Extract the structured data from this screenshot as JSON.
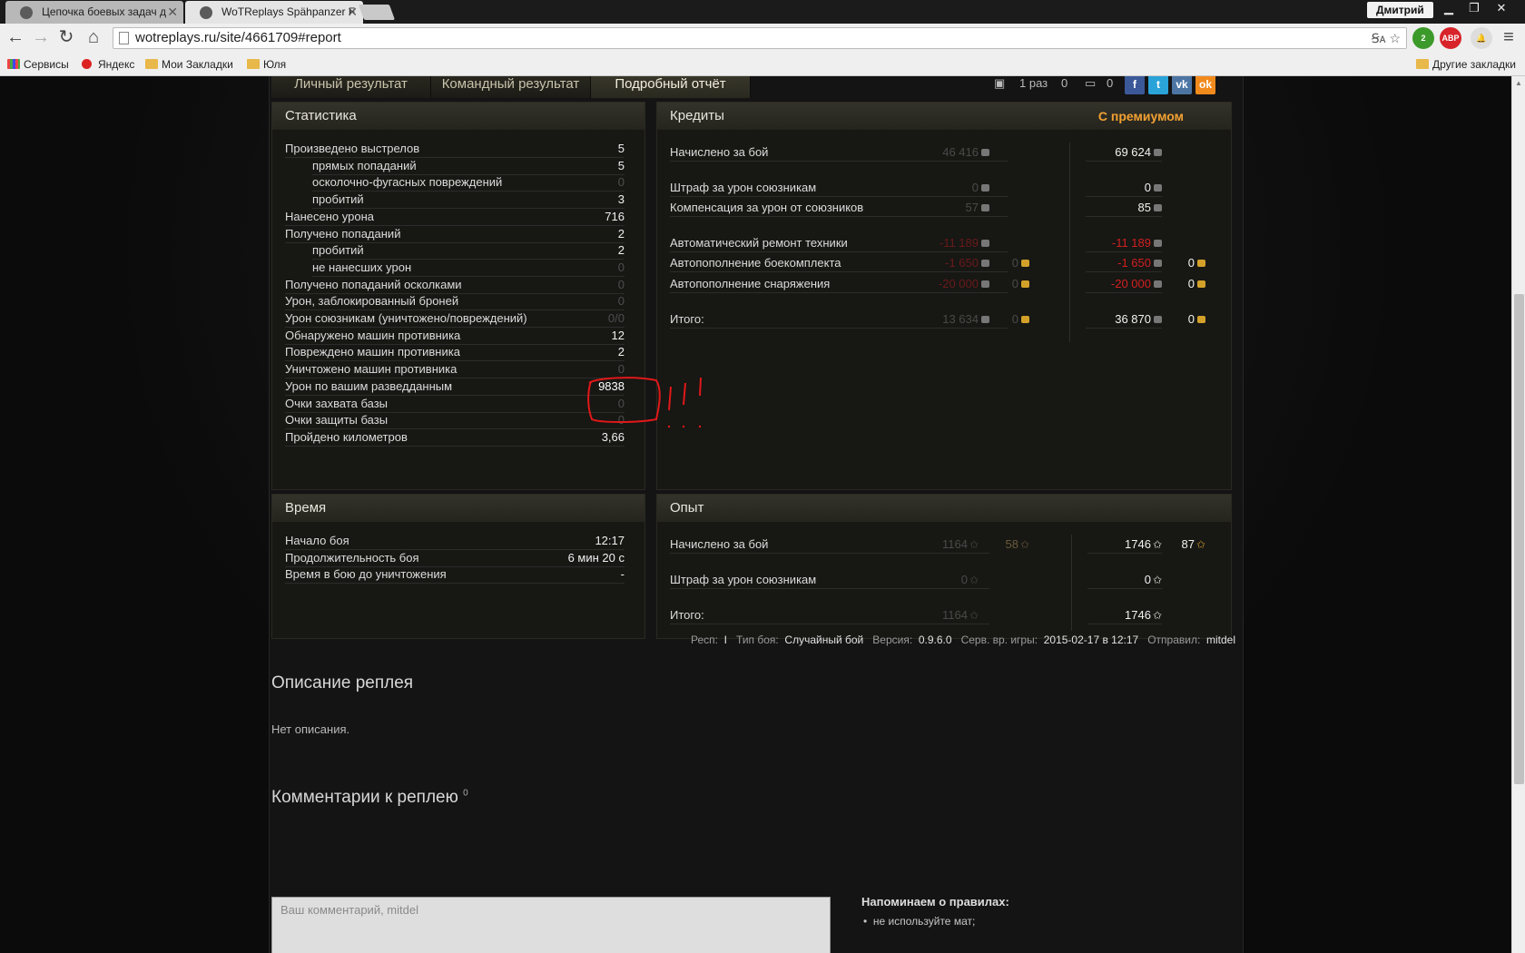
{
  "browser": {
    "tabs": [
      {
        "title": "Цепочка боевых задач д"
      },
      {
        "title": "WoTReplays Spähpanzer F"
      }
    ],
    "user": "Дмитрий",
    "url": "wotreplays.ru/site/4661709#report",
    "bookmarks": [
      "Сервисы",
      "Яндекс",
      "Мои Закладки",
      "Юля"
    ],
    "other_bookmarks": "Другие закладки",
    "ext_badge": "2",
    "ext_abp": "ABP"
  },
  "result_tabs": [
    "Личный результат",
    "Командный результат",
    "Подробный отчёт"
  ],
  "social": {
    "views": "1 раз",
    "downloads": "0",
    "comments": "0"
  },
  "statistics": {
    "title": "Статистика",
    "rows": [
      {
        "label": "Произведено выстрелов",
        "value": "5",
        "sub": false,
        "dim": false
      },
      {
        "label": "прямых попаданий",
        "value": "5",
        "sub": true,
        "dim": false
      },
      {
        "label": "осколочно-фугасных повреждений",
        "value": "0",
        "sub": true,
        "dim": true
      },
      {
        "label": "пробитий",
        "value": "3",
        "sub": true,
        "dim": false
      },
      {
        "label": "Нанесено урона",
        "value": "716",
        "sub": false,
        "dim": false
      },
      {
        "label": "Получено попаданий",
        "value": "2",
        "sub": false,
        "dim": false
      },
      {
        "label": "пробитий",
        "value": "2",
        "sub": true,
        "dim": false
      },
      {
        "label": "не нанесших урон",
        "value": "0",
        "sub": true,
        "dim": true
      },
      {
        "label": "Получено попаданий осколками",
        "value": "0",
        "sub": false,
        "dim": true
      },
      {
        "label": "Урон, заблокированный броней",
        "value": "0",
        "sub": false,
        "dim": true
      },
      {
        "label": "Урон союзникам (уничтожено/повреждений)",
        "value": "0/0",
        "sub": false,
        "dim": true
      },
      {
        "label": "Обнаружено машин противника",
        "value": "12",
        "sub": false,
        "dim": false
      },
      {
        "label": "Повреждено машин противника",
        "value": "2",
        "sub": false,
        "dim": false
      },
      {
        "label": "Уничтожено машин противника",
        "value": "0",
        "sub": false,
        "dim": true
      },
      {
        "label": "Урон по вашим разведданным",
        "value": "9838",
        "sub": false,
        "dim": false
      },
      {
        "label": "Очки захвата базы",
        "value": "0",
        "sub": false,
        "dim": true
      },
      {
        "label": "Очки защиты базы",
        "value": "0",
        "sub": false,
        "dim": true
      },
      {
        "label": "Пройдено километров",
        "value": "3,66",
        "sub": false,
        "dim": false
      }
    ]
  },
  "credits": {
    "title": "Кредиты",
    "premium_label": "С премиумом",
    "rows": [
      {
        "label": "Начислено за бой",
        "base": "46 416",
        "base_gold": "",
        "prem": "69 624",
        "prem_gold": "",
        "kind": "normal"
      },
      {
        "label": "Штраф за урон союзникам",
        "base": "0",
        "base_gold": "",
        "prem": "0",
        "prem_gold": "",
        "kind": "normal"
      },
      {
        "label": "Компенсация за урон от союзников",
        "base": "57",
        "base_gold": "",
        "prem": "85",
        "prem_gold": "",
        "kind": "normal"
      },
      {
        "label": "Автоматический ремонт техники",
        "base": "-11 189",
        "base_gold": "",
        "prem": "-11 189",
        "prem_gold": "",
        "kind": "red"
      },
      {
        "label": "Автопополнение боекомплекта",
        "base": "-1 650",
        "base_gold": "0",
        "prem": "-1 650",
        "prem_gold": "0",
        "kind": "red"
      },
      {
        "label": "Автопополнение снаряжения",
        "base": "-20 000",
        "base_gold": "0",
        "prem": "-20 000",
        "prem_gold": "0",
        "kind": "red"
      },
      {
        "label": "Итого:",
        "base": "13 634",
        "base_gold": "0",
        "prem": "36 870",
        "prem_gold": "0",
        "kind": "normal"
      }
    ]
  },
  "time": {
    "title": "Время",
    "rows": [
      {
        "label": "Начало боя",
        "value": "12:17"
      },
      {
        "label": "Продолжительность боя",
        "value": "6 мин 20 с"
      },
      {
        "label": "Время в бою до уничтожения",
        "value": "-"
      }
    ]
  },
  "experience": {
    "title": "Опыт",
    "rows": [
      {
        "label": "Начислено за бой",
        "base": "1164",
        "base_extra": "58",
        "prem": "1746",
        "prem_extra": "87"
      },
      {
        "label": "Штраф за урон союзникам",
        "base": "0",
        "base_extra": "",
        "prem": "0",
        "prem_extra": ""
      },
      {
        "label": "Итого:",
        "base": "1164",
        "base_extra": "",
        "prem": "1746",
        "prem_extra": ""
      }
    ]
  },
  "meta": {
    "resp_label": "Респ:",
    "resp_value": "I",
    "battle_type_label": "Тип боя:",
    "battle_type_value": "Случайный бой",
    "version_label": "Версия:",
    "version_value": "0.9.6.0",
    "server_time_label": "Серв. вр. игры:",
    "server_time_value": "2015-02-17 в 12:17",
    "sender_label": "Отправил:",
    "sender_value": "mitdel"
  },
  "description": {
    "title": "Описание реплея",
    "text": "Нет описания."
  },
  "comments": {
    "title": "Комментарии к реплею",
    "count": "0",
    "placeholder": "Ваш комментарий, mitdel",
    "rules_title": "Напоминаем о правилах:",
    "rule_1": "не используйте мат;"
  },
  "colors": {
    "accent": "#f2a132",
    "negative": "#d12020",
    "annotation": "#e01818"
  }
}
